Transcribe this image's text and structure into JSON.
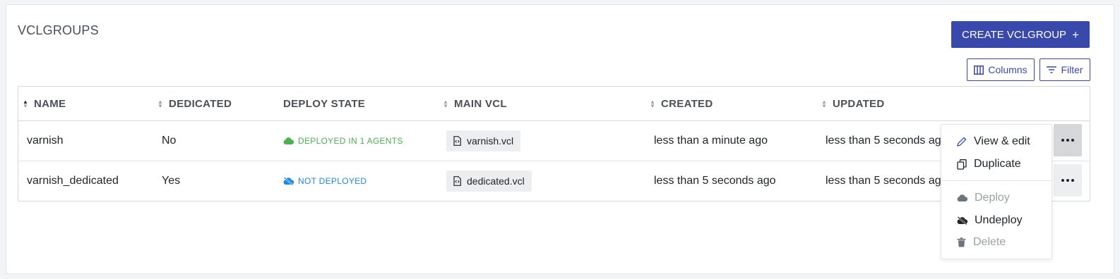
{
  "page": {
    "title": "VCLGROUPS"
  },
  "toolbar": {
    "create_label": "CREATE VCLGROUP",
    "create_icon": "+",
    "columns_label": "Columns",
    "filter_label": "Filter"
  },
  "table": {
    "headers": {
      "name": "NAME",
      "dedicated": "DEDICATED",
      "deploy_state": "DEPLOY STATE",
      "main_vcl": "MAIN VCL",
      "created": "CREATED",
      "updated": "UPDATED"
    },
    "rows": [
      {
        "name": "varnish",
        "dedicated": "No",
        "deploy_state": "DEPLOYED IN 1 AGENTS",
        "deploy_icon": "cloud-icon",
        "main_vcl": "varnish.vcl",
        "created": "less than a minute ago",
        "updated": "less than 5 seconds ago"
      },
      {
        "name": "varnish_dedicated",
        "dedicated": "Yes",
        "deploy_state": "NOT DEPLOYED",
        "deploy_icon": "cloud-off-icon",
        "main_vcl": "dedicated.vcl",
        "created": "less than 5 seconds ago",
        "updated": "less than 5 seconds ago"
      }
    ]
  },
  "context_menu": {
    "items": [
      {
        "label": "View & edit",
        "icon": "pencil-icon",
        "enabled": true
      },
      {
        "label": "Duplicate",
        "icon": "copy-icon",
        "enabled": true
      },
      {
        "label": "Deploy",
        "icon": "cloud-icon",
        "enabled": false
      },
      {
        "label": "Undeploy",
        "icon": "cloud-off-icon",
        "enabled": true
      },
      {
        "label": "Delete",
        "icon": "trash-icon",
        "enabled": false
      }
    ]
  },
  "colors": {
    "primary": "#3949ab",
    "deployed": "#4caf50",
    "not_deployed": "#1e88e5",
    "disabled": "#9aa0a6"
  }
}
